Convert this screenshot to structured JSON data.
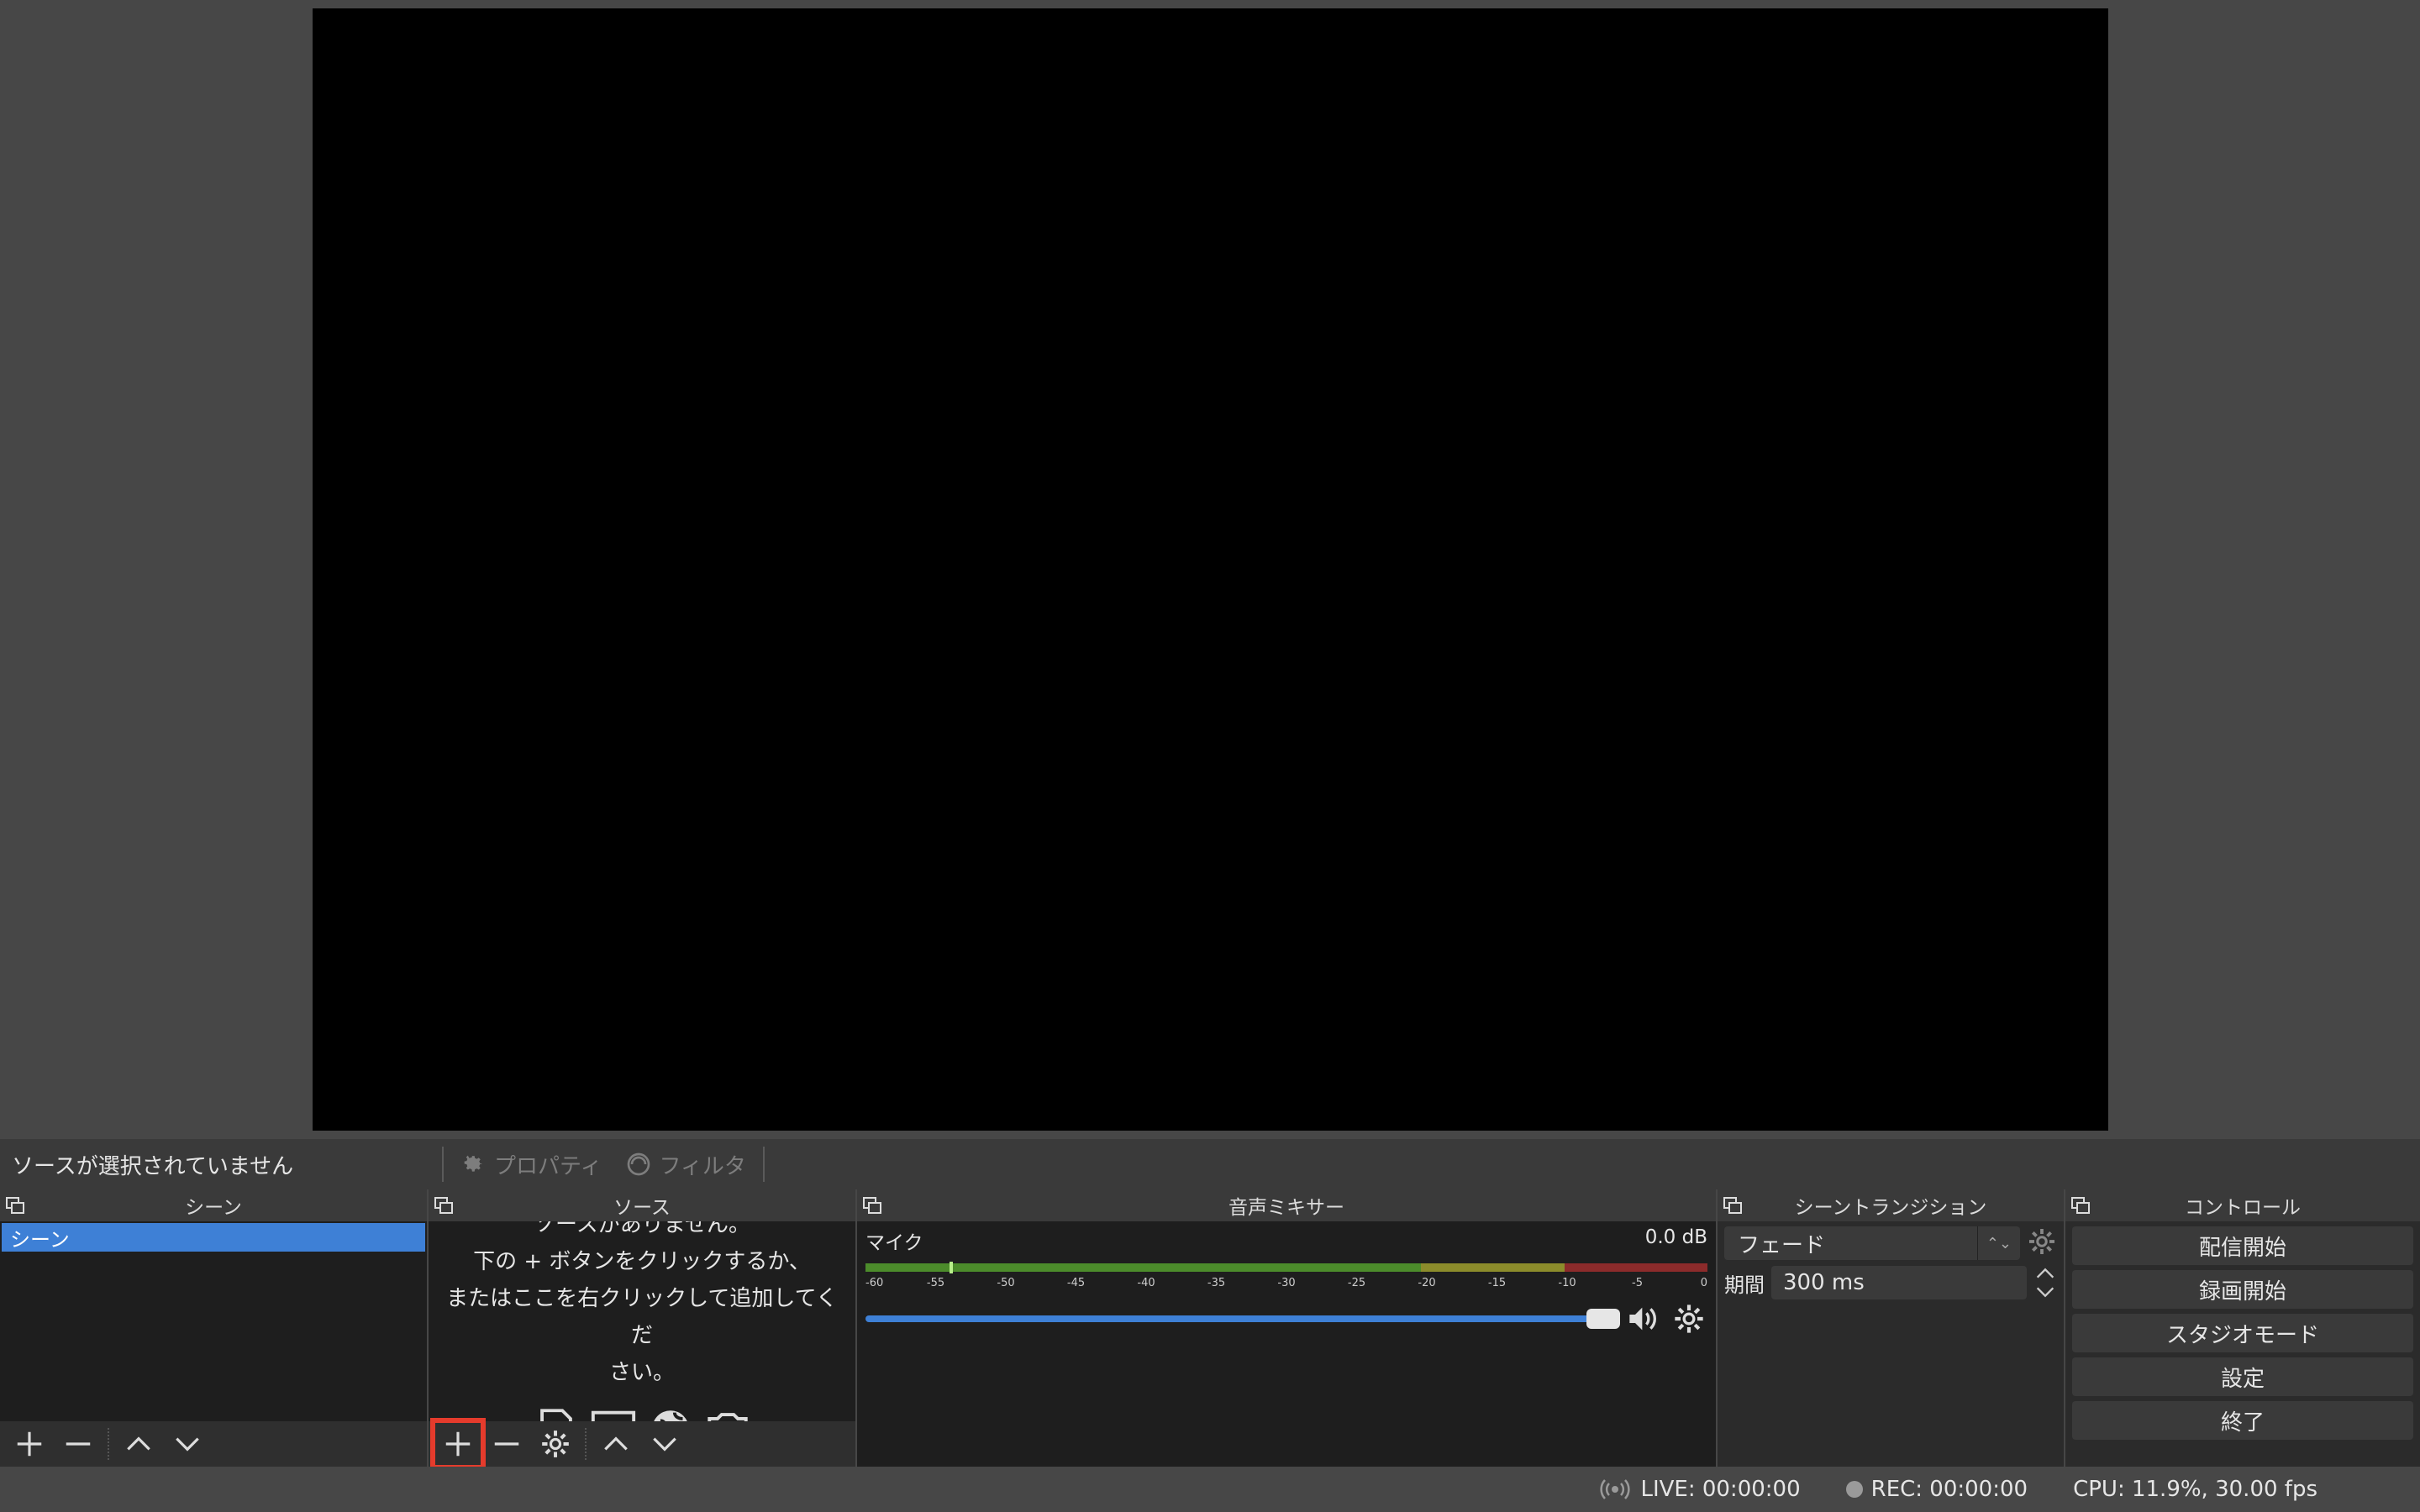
{
  "source_toolbar": {
    "status_text": "ソースが選択されていません",
    "properties_label": "プロパティ",
    "filters_label": "フィルタ"
  },
  "scenes": {
    "title": "シーン",
    "items": [
      "シーン"
    ]
  },
  "sources": {
    "title": "ソース",
    "empty_line1": "ソースがありません。",
    "empty_line2": "下の + ボタンをクリックするか、",
    "empty_line3": "またはここを右クリックして追加してくだ",
    "empty_line4": "さい。"
  },
  "mixer": {
    "title": "音声ミキサー",
    "channel_name": "マイク",
    "channel_level": "0.0 dB",
    "ticks": [
      "-60",
      "-55",
      "-50",
      "-45",
      "-40",
      "-35",
      "-30",
      "-25",
      "-20",
      "-15",
      "-10",
      "-5",
      "0"
    ],
    "volume_fraction": 1.0
  },
  "transitions": {
    "title": "シーントランジション",
    "selected": "フェード",
    "duration_label": "期間",
    "duration_value": "300 ms"
  },
  "controls": {
    "title": "コントロール",
    "start_streaming": "配信開始",
    "start_recording": "録画開始",
    "studio_mode": "スタジオモード",
    "settings": "設定",
    "exit": "終了"
  },
  "statusbar": {
    "live": "LIVE: 00:00:00",
    "rec": "REC: 00:00:00",
    "cpu": "CPU: 11.9%, 30.00 fps"
  },
  "colors": {
    "accent": "#3e80d6",
    "highlight": "#e53b2c",
    "meter_green": "#4c8c2b",
    "meter_yellow": "#8c8c2b",
    "meter_red": "#8c2b2b"
  }
}
